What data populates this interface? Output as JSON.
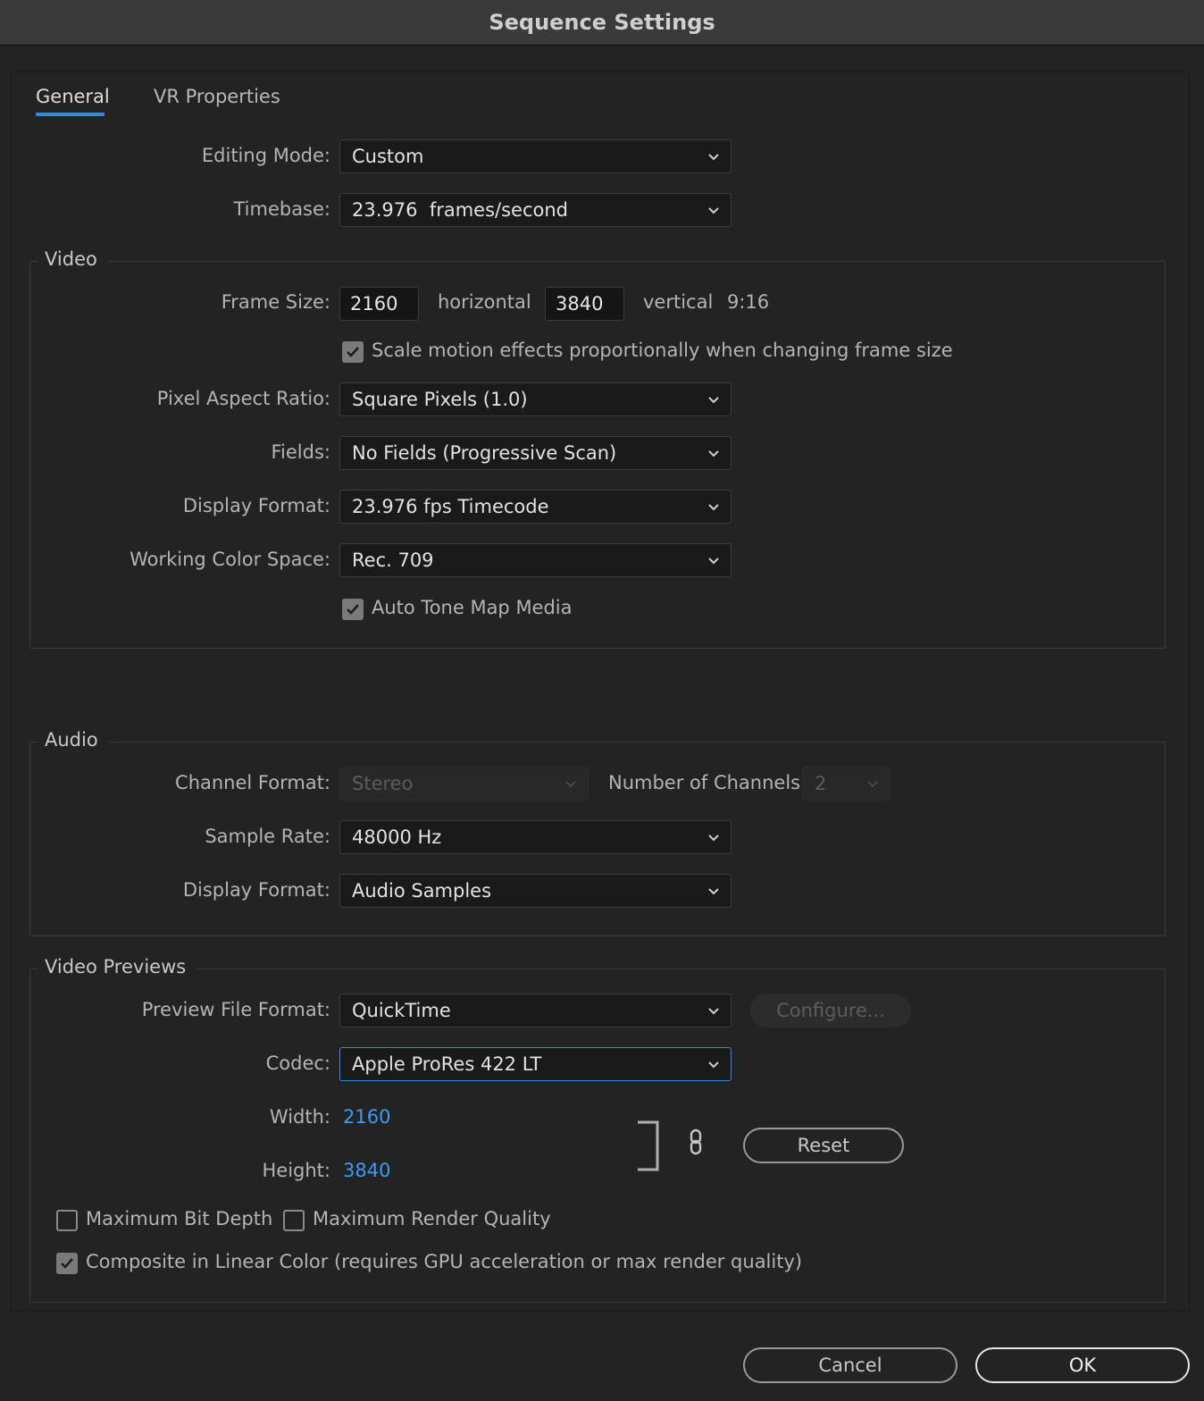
{
  "window": {
    "title": "Sequence Settings"
  },
  "tabs": [
    {
      "label": "General",
      "active": true
    },
    {
      "label": "VR Properties",
      "active": false
    }
  ],
  "general": {
    "editing_mode_label": "Editing Mode:",
    "editing_mode_value": "Custom",
    "timebase_label": "Timebase:",
    "timebase_value": "23.976  frames/second"
  },
  "video": {
    "legend": "Video",
    "frame_size_label": "Frame Size:",
    "frame_width": "2160",
    "horizontal_label": "horizontal",
    "frame_height": "3840",
    "vertical_label": "vertical",
    "aspect": "9:16",
    "scale_motion_label": "Scale motion effects proportionally when changing frame size",
    "scale_motion_checked": true,
    "pixel_aspect_label": "Pixel Aspect Ratio:",
    "pixel_aspect_value": "Square Pixels (1.0)",
    "fields_label": "Fields:",
    "fields_value": "No Fields (Progressive Scan)",
    "display_format_label": "Display Format:",
    "display_format_value": "23.976 fps Timecode",
    "color_space_label": "Working Color Space:",
    "color_space_value": "Rec. 709",
    "auto_tone_label": "Auto Tone Map Media",
    "auto_tone_checked": true
  },
  "audio": {
    "legend": "Audio",
    "channel_format_label": "Channel Format:",
    "channel_format_value": "Stereo",
    "num_channels_label": "Number of Channels:",
    "num_channels_value": "2",
    "sample_rate_label": "Sample Rate:",
    "sample_rate_value": "48000 Hz",
    "display_format_label": "Display Format:",
    "display_format_value": "Audio Samples"
  },
  "previews": {
    "legend": "Video Previews",
    "file_format_label": "Preview File Format:",
    "file_format_value": "QuickTime",
    "configure_label": "Configure...",
    "codec_label": "Codec:",
    "codec_value": "Apple ProRes 422 LT",
    "width_label": "Width:",
    "width_value": "2160",
    "height_label": "Height:",
    "height_value": "3840",
    "reset_label": "Reset",
    "max_bit_depth_label": "Maximum Bit Depth",
    "max_bit_depth_checked": false,
    "max_render_quality_label": "Maximum Render Quality",
    "max_render_quality_checked": false,
    "linear_color_label": "Composite in Linear Color (requires GPU acceleration or max render quality)",
    "linear_color_checked": true
  },
  "footer": {
    "cancel_label": "Cancel",
    "ok_label": "OK"
  },
  "colors": {
    "accent": "#2d8ceb",
    "link_value": "#3d9bf0",
    "background": "#232323"
  },
  "icons": [
    "chevron-down-icon",
    "checkmark-icon",
    "link-icon",
    "bracket-icon"
  ]
}
